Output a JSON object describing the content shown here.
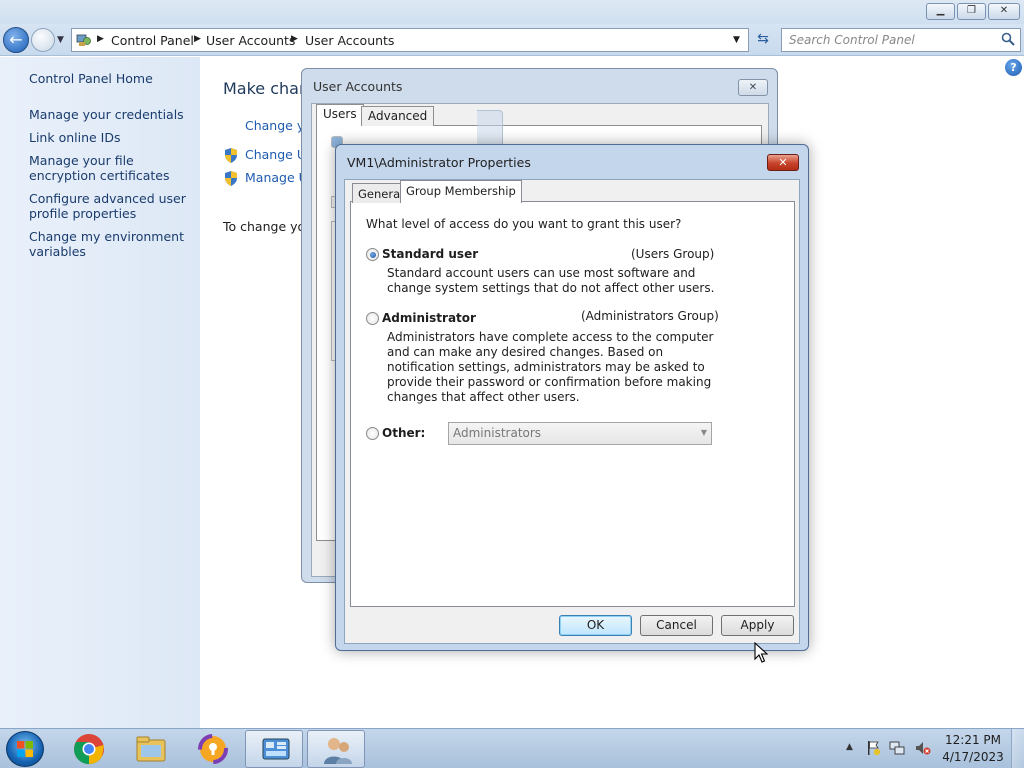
{
  "window": {
    "caption_buttons": {
      "minimize_icon": "minimize-icon",
      "maximize_icon": "maximize-icon",
      "close_icon": "close-icon"
    }
  },
  "address_bar": {
    "breadcrumbs": [
      "Control Panel",
      "User Accounts",
      "User Accounts"
    ],
    "icons": {
      "back": "back-arrow-icon",
      "forward": "forward-arrow-icon",
      "refresh": "refresh-icon",
      "location": "control-panel-icon"
    }
  },
  "search": {
    "placeholder": "Search Control Panel",
    "value": ""
  },
  "sidebar": {
    "home": "Control Panel Home",
    "items": [
      "Manage your credentials",
      "Link online IDs",
      "Manage your file encryption certificates",
      "Configure advanced user profile properties",
      "Change my environment variables"
    ]
  },
  "content": {
    "heading": "Make chang",
    "links": [
      "Change yo",
      "Change Us",
      "Manage Us"
    ],
    "text": "To change you"
  },
  "user_accounts_dialog": {
    "title": "User Accounts",
    "tabs": [
      "Users",
      "Advanced"
    ],
    "active_tab": "Users"
  },
  "properties_dialog": {
    "title": "VM1\\Administrator Properties",
    "tabs": [
      "General",
      "Group Membership"
    ],
    "active_tab": "Group Membership",
    "question": "What level of access do you want to grant this user?",
    "options": [
      {
        "label": "Standard user",
        "group": "(Users Group)",
        "description": "Standard account users can use most software and change system settings that do not affect other users.",
        "selected": true
      },
      {
        "label": "Administrator",
        "group": "(Administrators Group)",
        "description": "Administrators have complete access to the computer and can make any desired changes. Based on notification settings, administrators may be asked to provide their password or confirmation before making changes that affect other users.",
        "selected": false
      },
      {
        "label": "Other:",
        "group": "",
        "description": "",
        "selected": false
      }
    ],
    "other_select": {
      "value": "Administrators",
      "disabled": true
    },
    "buttons": {
      "ok": "OK",
      "cancel": "Cancel",
      "apply": "Apply"
    }
  },
  "taskbar": {
    "items": [
      "start-button",
      "chrome-icon",
      "file-explorer-icon",
      "app-icon",
      "control-panel-icon",
      "user-accounts-icon"
    ],
    "tray_icons": [
      "show-hidden-icons-arrow",
      "action-center-flag-icon",
      "network-icon",
      "volume-muted-icon"
    ],
    "clock": {
      "time": "12:21 PM",
      "date": "4/17/2023"
    }
  },
  "colors": {
    "link": "#1e5bb0",
    "sidebar_link": "#1a3c6c",
    "dialog_frame": "#c4d6ec",
    "taskbar": "#b7cbe2",
    "close_red": "#c8432b"
  }
}
